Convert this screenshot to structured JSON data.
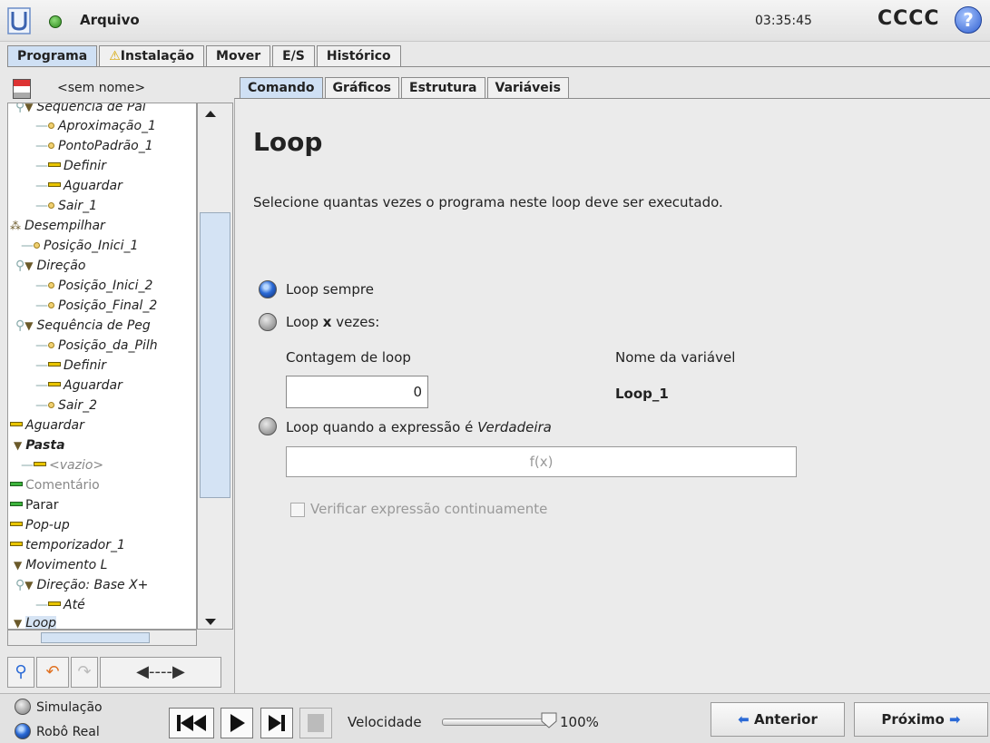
{
  "header": {
    "file_menu": "Arquivo",
    "clock": "03:35:45",
    "robot_name": "CCCC",
    "help_glyph": "?"
  },
  "main_tabs": [
    {
      "label": "Programa",
      "active": true
    },
    {
      "label": "Instalação",
      "warning": true
    },
    {
      "label": "Mover"
    },
    {
      "label": "E/S"
    },
    {
      "label": "Histórico"
    }
  ],
  "program": {
    "name": "<sem nome>"
  },
  "tree": [
    {
      "label": "Sequência de Pal",
      "icon": "triangle"
    },
    {
      "label": "Aproximação_1",
      "icon": "dot"
    },
    {
      "label": "PontoPadrão_1",
      "icon": "dot"
    },
    {
      "label": "Definir",
      "icon": "bar"
    },
    {
      "label": "Aguardar",
      "icon": "bar"
    },
    {
      "label": "Sair_1",
      "icon": "dot"
    },
    {
      "label": "Desempilhar",
      "icon": "cluster"
    },
    {
      "label": "Posição_Inici_1",
      "icon": "dot"
    },
    {
      "label": "Direção",
      "icon": "triangle"
    },
    {
      "label": "Posição_Inici_2",
      "icon": "dot"
    },
    {
      "label": "Posição_Final_2",
      "icon": "dot"
    },
    {
      "label": "Sequência de Peg",
      "icon": "triangle"
    },
    {
      "label": "Posição_da_Pilh",
      "icon": "dot"
    },
    {
      "label": "Definir",
      "icon": "bar"
    },
    {
      "label": "Aguardar",
      "icon": "bar"
    },
    {
      "label": "Sair_2",
      "icon": "dot"
    },
    {
      "label": "Aguardar",
      "icon": "bar"
    },
    {
      "label": "Pasta",
      "icon": "triangle"
    },
    {
      "label": "<vazio>",
      "icon": "bar"
    },
    {
      "label": "Comentário",
      "icon": "bar-green"
    },
    {
      "label": "Parar",
      "icon": "bar-green"
    },
    {
      "label": "Pop-up",
      "icon": "bar"
    },
    {
      "label": "temporizador_1",
      "icon": "bar"
    },
    {
      "label": "Movimento L",
      "icon": "triangle"
    },
    {
      "label": "Direção: Base X+",
      "icon": "triangle"
    },
    {
      "label": "Até",
      "icon": "bar"
    },
    {
      "label": "Loop",
      "icon": "triangle",
      "selected": true
    }
  ],
  "sub_tabs": [
    {
      "label": "Comando",
      "active": true
    },
    {
      "label": "Gráficos"
    },
    {
      "label": "Estrutura"
    },
    {
      "label": "Variáveis"
    }
  ],
  "panel": {
    "title": "Loop",
    "description": "Selecione quantas vezes o programa neste loop deve ser executado.",
    "option_always": "Loop sempre",
    "option_times_prefix": "Loop",
    "option_times_x": "x",
    "option_times_suffix": "vezes:",
    "count_label": "Contagem de loop",
    "count_value": "0",
    "var_name_label": "Nome da variável",
    "var_name_value": "Loop_1",
    "option_expr_prefix": "Loop quando a expressão é",
    "option_expr_italic": "Verdadeira",
    "expr_placeholder": "f(x)",
    "check_continuous": "Verificar expressão continuamente",
    "selected_option": "always"
  },
  "footer": {
    "simulation": "Simulação",
    "real_robot": "Robô Real",
    "speed_label": "Velocidade",
    "speed_value": "100%",
    "speed_fraction": 1.0,
    "prev": "Anterior",
    "next": "Próximo"
  },
  "colors": {
    "accent_blue": "#2b6ad6",
    "active_tab": "#cfe0f4"
  }
}
